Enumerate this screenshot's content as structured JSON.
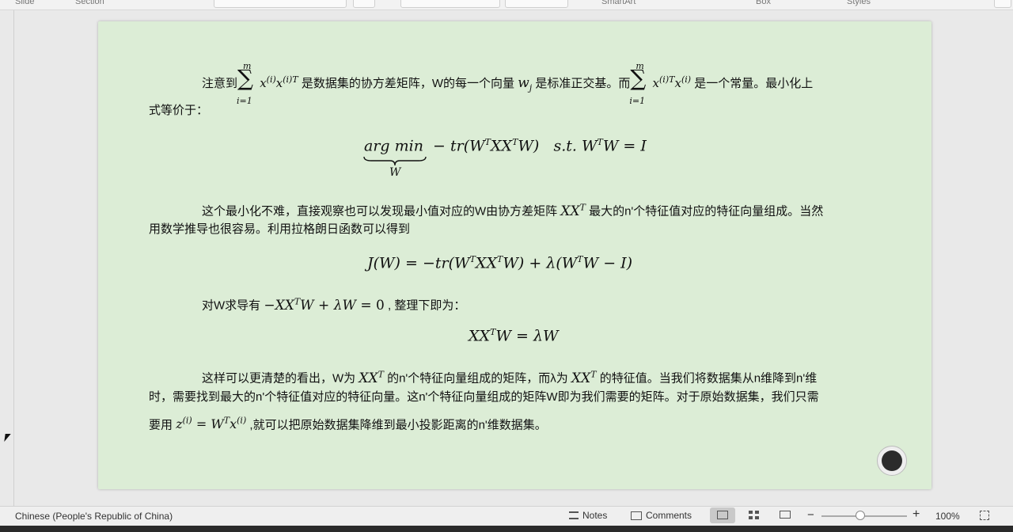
{
  "ribbon": {
    "slide_label": "Slide",
    "section_label": "Section",
    "smartart_label": "SmartArt",
    "box_label": "Box",
    "styles_label": "Styles"
  },
  "slide": {
    "p1_a": "注意到",
    "p1_b": "是数据集的协方差矩阵，W的每一个向量",
    "p1_c": "是标准正交基。而",
    "p1_d": "是一个常量。最小化上",
    "p1_e": "式等价于：",
    "p2_line1": "这个最小化不难，直接观察也可以发现最小值对应的W由协方差矩阵",
    "p2_line1_b": "最大的n'个特征值对应的特征向量组成。当然",
    "p2_line2": "用数学推导也很容易。利用拉格朗日函数可以得到",
    "p3_a": "对W求导有",
    "p3_b": ", 整理下即为：",
    "p4_a": "这样可以更清楚的看出，W为",
    "p4_b": "的n'个特征向量组成的矩阵，而λ为",
    "p4_c": "的特征值。当我们将数据集从n维降到n'维",
    "p4_line2": "时，需要找到最大的n'个特征值对应的特征向量。这n'个特征向量组成的矩阵W即为我们需要的矩阵。对于原始数据集，我们只需",
    "p4_line3_a": "要用",
    "p4_line3_b": ",就可以把原始数据集降维到最小投影距离的n'维数据集。"
  },
  "statusbar": {
    "language": "Chinese (People's Republic of China)",
    "notes_label": "Notes",
    "comments_label": "Comments",
    "zoom_level": "100%",
    "zoom_fraction": 0.45
  }
}
